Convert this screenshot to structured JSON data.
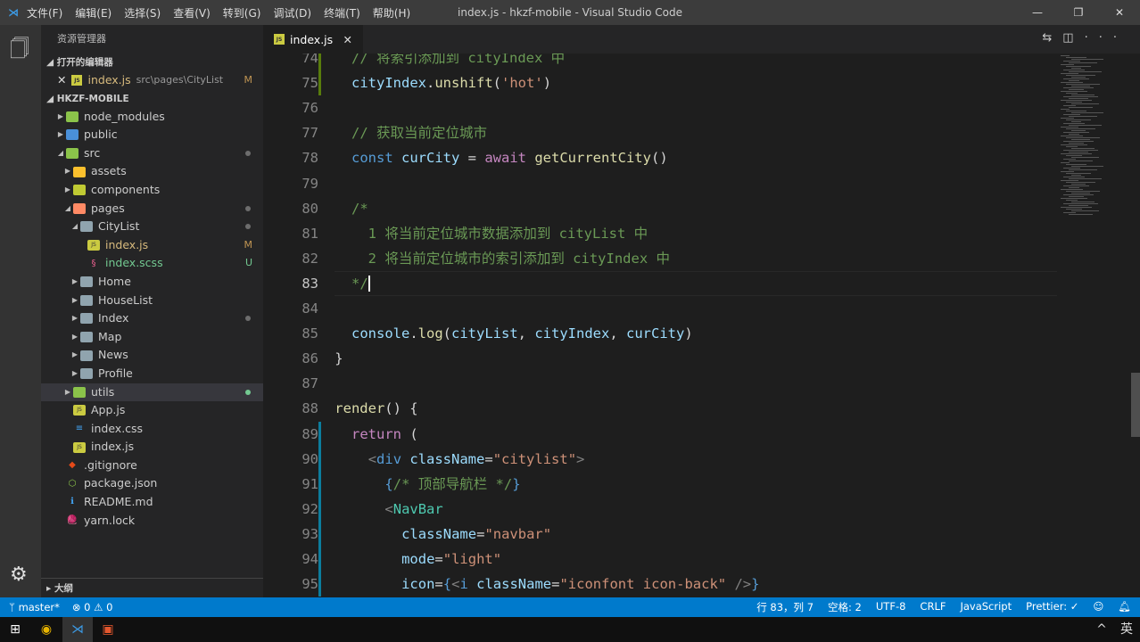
{
  "titlebar": {
    "menus": [
      "文件(F)",
      "编辑(E)",
      "选择(S)",
      "查看(V)",
      "转到(G)",
      "调试(D)",
      "终端(T)",
      "帮助(H)"
    ],
    "title": "index.js - hkzf-mobile - Visual Studio Code"
  },
  "sidebar": {
    "header": "资源管理器",
    "open_editors": "打开的编辑器",
    "open_file": {
      "name": "index.js",
      "path": "src\\pages\\CityList",
      "badge": "M"
    },
    "project": "HKZF-MOBILE",
    "tree": [
      {
        "name": "node_modules",
        "depth": 0,
        "type": "folder",
        "color": "#8bc34a",
        "open": false
      },
      {
        "name": "public",
        "depth": 0,
        "type": "folder",
        "color": "#4a90d9",
        "open": false
      },
      {
        "name": "src",
        "depth": 0,
        "type": "folder",
        "color": "#8bc34a",
        "open": true,
        "dot": true
      },
      {
        "name": "assets",
        "depth": 1,
        "type": "folder",
        "color": "#fbc02d",
        "open": false
      },
      {
        "name": "components",
        "depth": 1,
        "type": "folder",
        "color": "#c0ca33",
        "open": false
      },
      {
        "name": "pages",
        "depth": 1,
        "type": "folder",
        "color": "#ff8a65",
        "open": true,
        "dot": true
      },
      {
        "name": "CityList",
        "depth": 2,
        "type": "folder",
        "color": "#90a4ae",
        "open": true,
        "dot": true
      },
      {
        "name": "index.js",
        "depth": 3,
        "type": "js",
        "color": "#cbcb41",
        "badge": "M"
      },
      {
        "name": "index.scss",
        "depth": 3,
        "type": "scss",
        "color": "#f06292",
        "badge": "U"
      },
      {
        "name": "Home",
        "depth": 2,
        "type": "folder",
        "color": "#90a4ae",
        "open": false
      },
      {
        "name": "HouseList",
        "depth": 2,
        "type": "folder",
        "color": "#90a4ae",
        "open": false
      },
      {
        "name": "Index",
        "depth": 2,
        "type": "folder",
        "color": "#90a4ae",
        "open": false,
        "dot": true
      },
      {
        "name": "Map",
        "depth": 2,
        "type": "folder",
        "color": "#90a4ae",
        "open": false
      },
      {
        "name": "News",
        "depth": 2,
        "type": "folder",
        "color": "#90a4ae",
        "open": false
      },
      {
        "name": "Profile",
        "depth": 2,
        "type": "folder",
        "color": "#90a4ae",
        "open": false
      },
      {
        "name": "utils",
        "depth": 1,
        "type": "folder",
        "color": "#8bc34a",
        "open": false,
        "dot": true,
        "selected": true
      },
      {
        "name": "App.js",
        "depth": 1,
        "type": "js",
        "color": "#cbcb41"
      },
      {
        "name": "index.css",
        "depth": 1,
        "type": "css",
        "color": "#42a5f5"
      },
      {
        "name": "index.js",
        "depth": 1,
        "type": "js",
        "color": "#cbcb41"
      },
      {
        "name": ".gitignore",
        "depth": 0,
        "type": "git",
        "color": "#e64a19"
      },
      {
        "name": "package.json",
        "depth": 0,
        "type": "npm",
        "color": "#8bc34a"
      },
      {
        "name": "README.md",
        "depth": 0,
        "type": "info",
        "color": "#42a5f5"
      },
      {
        "name": "yarn.lock",
        "depth": 0,
        "type": "yarn",
        "color": "#2c8ebb"
      }
    ],
    "outline": "大纲"
  },
  "tab": {
    "label": "index.js"
  },
  "editor": {
    "current_line": 83,
    "lines": [
      {
        "n": 74,
        "i": 1,
        "t": [
          [
            "// 将索引添加到 cityIndex 中",
            "c"
          ]
        ]
      },
      {
        "n": 75,
        "i": 1,
        "t": [
          [
            "cityIndex",
            "v"
          ],
          [
            ".",
            ""
          ],
          [
            "unshift",
            "f"
          ],
          [
            "(",
            ""
          ],
          [
            "'hot'",
            "s"
          ],
          [
            ")",
            ""
          ]
        ]
      },
      {
        "n": 76,
        "i": 1,
        "t": []
      },
      {
        "n": 77,
        "i": 1,
        "t": [
          [
            "// 获取当前定位城市",
            "c"
          ]
        ]
      },
      {
        "n": 78,
        "i": 1,
        "t": [
          [
            "const ",
            "k"
          ],
          [
            "curCity",
            "v"
          ],
          [
            " = ",
            ""
          ],
          [
            "await ",
            "kc"
          ],
          [
            "getCurrentCity",
            "f"
          ],
          [
            "()",
            ""
          ]
        ]
      },
      {
        "n": 79,
        "i": 1,
        "t": []
      },
      {
        "n": 80,
        "i": 1,
        "t": [
          [
            "/*",
            "c"
          ]
        ]
      },
      {
        "n": 81,
        "i": 1,
        "t": [
          [
            "  1 将当前定位城市数据添加到 cityList 中",
            "c"
          ]
        ]
      },
      {
        "n": 82,
        "i": 1,
        "t": [
          [
            "  2 将当前定位城市的索引添加到 cityIndex 中",
            "c"
          ]
        ]
      },
      {
        "n": 83,
        "i": 1,
        "t": [
          [
            "*/",
            "c"
          ]
        ]
      },
      {
        "n": 84,
        "i": 1,
        "t": []
      },
      {
        "n": 85,
        "i": 1,
        "t": [
          [
            "console",
            "v"
          ],
          [
            ".",
            ""
          ],
          [
            "log",
            "f"
          ],
          [
            "(",
            ""
          ],
          [
            "cityList",
            "v"
          ],
          [
            ", ",
            ""
          ],
          [
            "cityIndex",
            "v"
          ],
          [
            ", ",
            ""
          ],
          [
            "curCity",
            "v"
          ],
          [
            ")",
            ""
          ]
        ]
      },
      {
        "n": 86,
        "i": 0,
        "t": [
          [
            "}",
            ""
          ]
        ]
      },
      {
        "n": 87,
        "i": 0,
        "t": []
      },
      {
        "n": 88,
        "i": 0,
        "t": [
          [
            "render",
            "f"
          ],
          [
            "() {",
            ""
          ]
        ]
      },
      {
        "n": 89,
        "i": 1,
        "t": [
          [
            "return ",
            "kc"
          ],
          [
            "(",
            ""
          ]
        ]
      },
      {
        "n": 90,
        "i": 2,
        "t": [
          [
            "<",
            "p"
          ],
          [
            "div ",
            "b"
          ],
          [
            "className",
            "v"
          ],
          [
            "=",
            ""
          ],
          [
            "\"citylist\"",
            "s"
          ],
          [
            ">",
            "p"
          ]
        ]
      },
      {
        "n": 91,
        "i": 3,
        "t": [
          [
            "{",
            "b"
          ],
          [
            "/* 顶部导航栏 */",
            "c"
          ],
          [
            "}",
            "b"
          ]
        ]
      },
      {
        "n": 92,
        "i": 3,
        "t": [
          [
            "<",
            "p"
          ],
          [
            "NavBar",
            "t"
          ]
        ]
      },
      {
        "n": 93,
        "i": 4,
        "t": [
          [
            "className",
            "v"
          ],
          [
            "=",
            ""
          ],
          [
            "\"navbar\"",
            "s"
          ]
        ]
      },
      {
        "n": 94,
        "i": 4,
        "t": [
          [
            "mode",
            "v"
          ],
          [
            "=",
            ""
          ],
          [
            "\"light\"",
            "s"
          ]
        ]
      },
      {
        "n": 95,
        "i": 4,
        "t": [
          [
            "icon",
            "v"
          ],
          [
            "=",
            ""
          ],
          [
            "{",
            "b"
          ],
          [
            "<",
            "p"
          ],
          [
            "i ",
            "b"
          ],
          [
            "className",
            "v"
          ],
          [
            "=",
            ""
          ],
          [
            "\"iconfont icon-back\"",
            "s"
          ],
          [
            " />",
            "p"
          ],
          [
            "}",
            "b"
          ]
        ]
      }
    ]
  },
  "status": {
    "branch": "master*",
    "errors": "0",
    "warnings": "0",
    "position": "行 83，列 7",
    "spaces": "空格: 2",
    "encoding": "UTF-8",
    "eol": "CRLF",
    "language": "JavaScript",
    "formatter": "Prettier: ✓"
  },
  "taskbar": {
    "ime": "英"
  },
  "colors": {
    "accent": "#007acc",
    "editor_bg": "#1e1e1e",
    "sidebar_bg": "#252526"
  }
}
